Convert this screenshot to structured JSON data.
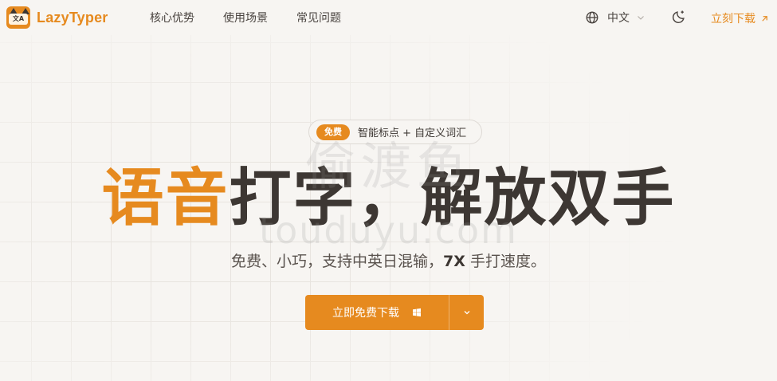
{
  "header": {
    "logo_text": "LazyTyper",
    "logo_mark_text": "文A",
    "nav": [
      "核心优势",
      "使用场景",
      "常见问题"
    ],
    "language": "中文",
    "download_link": "立刻下载"
  },
  "hero": {
    "badge_pill": "免费",
    "badge_text": "智能标点 + 自定义词汇",
    "headline_accent": "语音",
    "headline_rest": "打字，解放双手",
    "subtitle_start": "免费、小巧，支持中英日混输，",
    "subtitle_strong": "7X",
    "subtitle_end": " 手打速度。",
    "download_button": "立即免费下载"
  },
  "watermark": {
    "line1": "偷渡鱼",
    "line2": "touduyu.com"
  },
  "colors": {
    "accent": "#e68a1f",
    "text": "#3d3733",
    "background": "#f7f5f2"
  },
  "icons": {
    "language": "globe-icon",
    "theme": "moon-stars-icon",
    "external": "arrow-up-right-icon",
    "platform": "windows-icon",
    "dropdown": "chevron-down-icon"
  }
}
